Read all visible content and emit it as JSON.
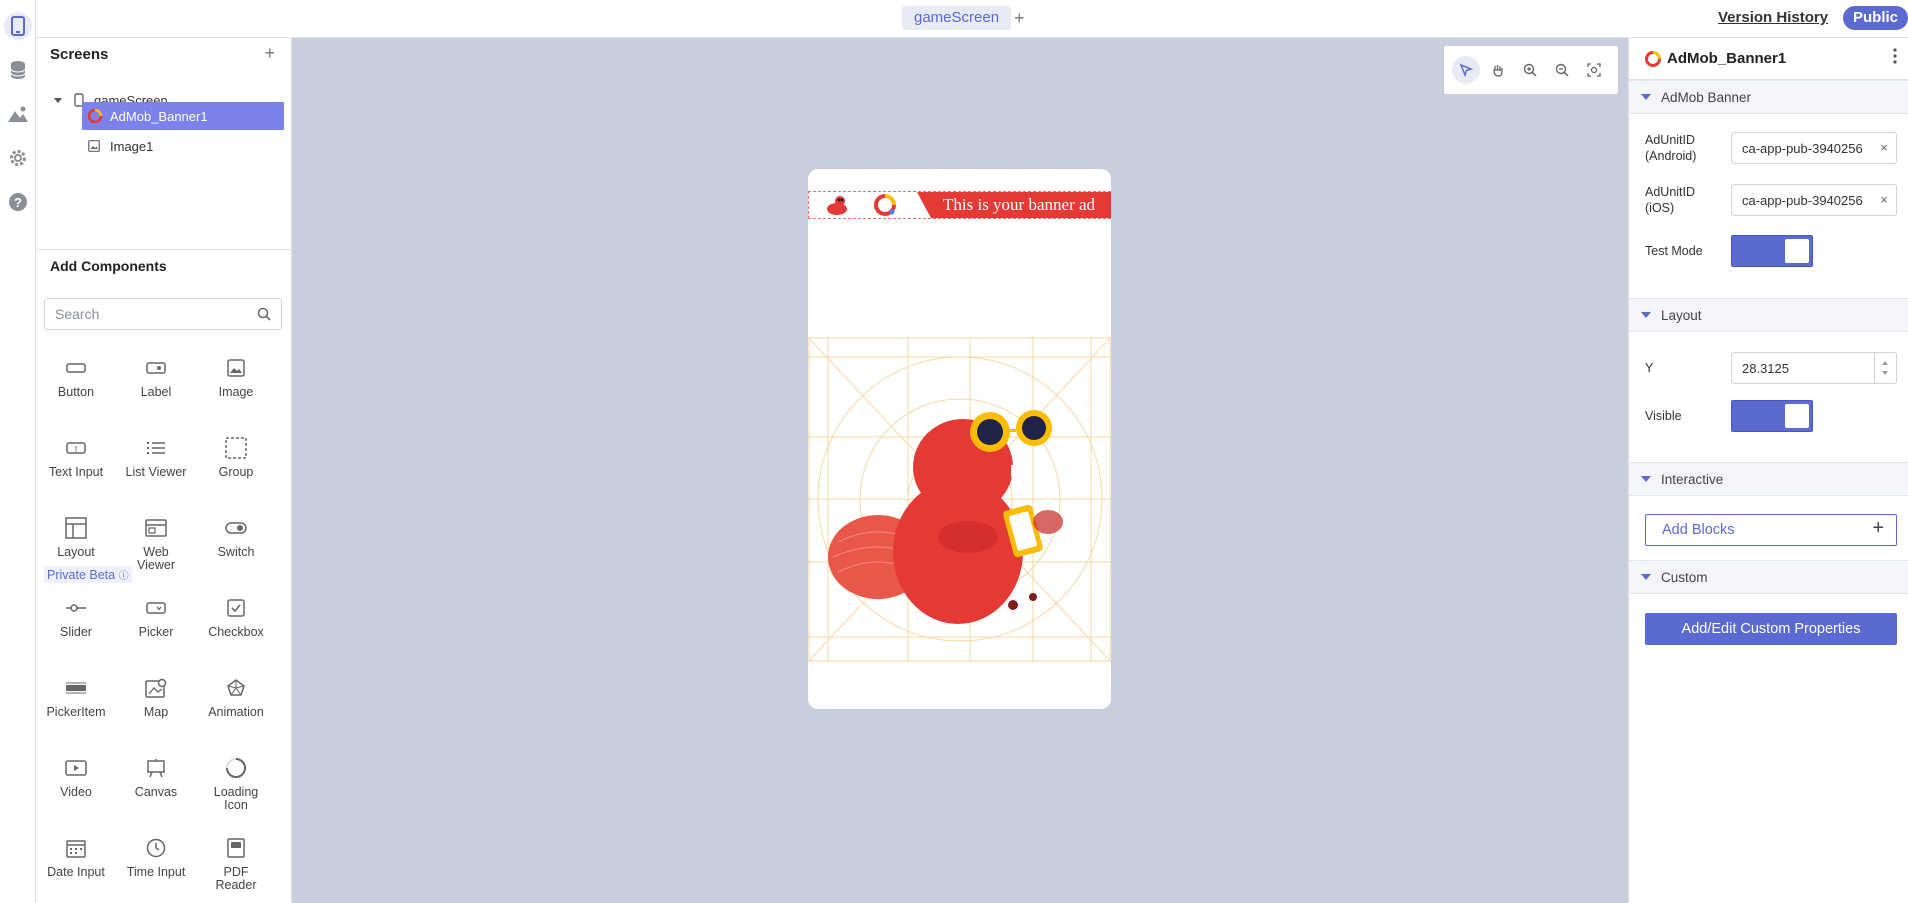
{
  "topbar": {
    "tab_label": "gameScreen",
    "add_tab": "+",
    "version_history": "Version History",
    "public_label": "Public"
  },
  "screens": {
    "title": "Screens",
    "add": "+",
    "tree": [
      {
        "label": "gameScreen",
        "icon": "phone-icon"
      },
      {
        "label": "AdMob_Banner1",
        "icon": "admob-icon",
        "selected": true
      },
      {
        "label": "Image1",
        "icon": "image-icon"
      }
    ]
  },
  "components": {
    "title": "Add Components",
    "search_placeholder": "Search",
    "beta_label": "Private Beta",
    "items": [
      {
        "label": "Button",
        "icon": "button-icon"
      },
      {
        "label": "Label",
        "icon": "label-icon"
      },
      {
        "label": "Image",
        "icon": "image-icon"
      },
      {
        "label": "Text Input",
        "icon": "text-input-icon"
      },
      {
        "label": "List Viewer",
        "icon": "list-icon"
      },
      {
        "label": "Group",
        "icon": "group-icon"
      },
      {
        "label": "Layout",
        "icon": "layout-icon"
      },
      {
        "label": "Web\nViewer",
        "icon": "web-viewer-icon"
      },
      {
        "label": "Switch",
        "icon": "switch-icon"
      },
      {
        "label": "Slider",
        "icon": "slider-icon"
      },
      {
        "label": "Picker",
        "icon": "picker-icon"
      },
      {
        "label": "Checkbox",
        "icon": "checkbox-icon"
      },
      {
        "label": "PickerItem",
        "icon": "picker-item-icon"
      },
      {
        "label": "Map",
        "icon": "map-icon"
      },
      {
        "label": "Animation",
        "icon": "animation-icon"
      },
      {
        "label": "Video",
        "icon": "video-icon"
      },
      {
        "label": "Canvas",
        "icon": "canvas-icon"
      },
      {
        "label": "Loading\nIcon",
        "icon": "loading-icon"
      },
      {
        "label": "Date Input",
        "icon": "calendar-icon"
      },
      {
        "label": "Time Input",
        "icon": "clock-icon"
      },
      {
        "label": "PDF\nReader",
        "icon": "pdf-icon"
      }
    ]
  },
  "canvas": {
    "banner_text": "This is your banner ad"
  },
  "props": {
    "title": "AdMob_Banner1",
    "sections": {
      "admob": "AdMob Banner",
      "layout": "Layout",
      "interactive": "Interactive",
      "custom": "Custom"
    },
    "android_label": "AdUnitID\n(Android)",
    "android_value": "ca-app-pub-3940256",
    "ios_label": "AdUnitID\n(iOS)",
    "ios_value": "ca-app-pub-3940256",
    "clear": "×",
    "test_mode_label": "Test Mode",
    "y_label": "Y",
    "y_value": "28.3125",
    "visible_label": "Visible",
    "add_blocks": "Add Blocks",
    "add_blocks_plus": "+",
    "custom_button": "Add/Edit Custom Properties"
  },
  "colors": {
    "accent": "#5b6ad0",
    "selected": "#7c82ea",
    "canvas_bg": "#c9cedd",
    "banner_red": "#e53935"
  }
}
